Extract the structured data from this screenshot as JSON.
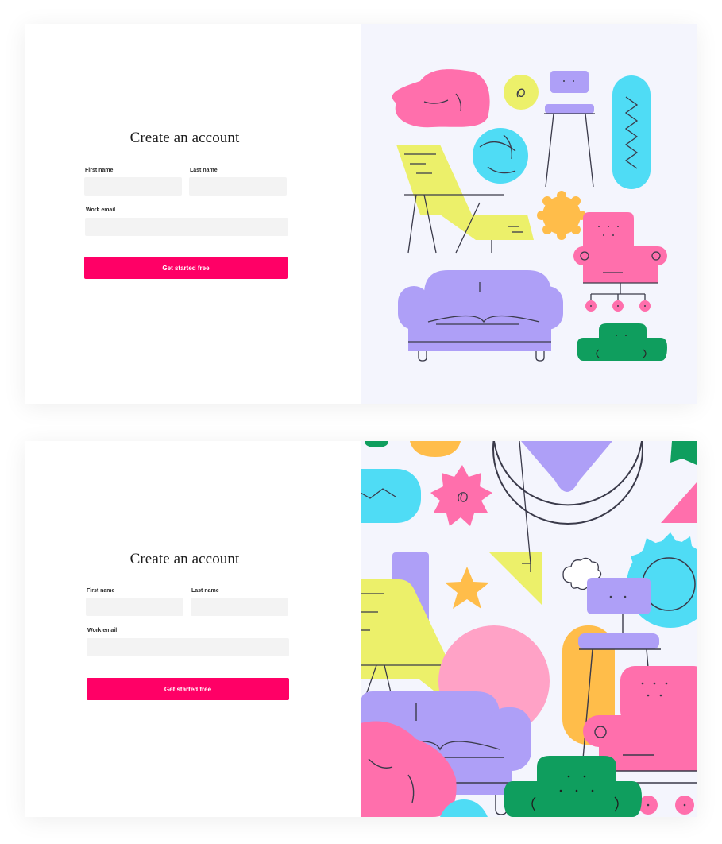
{
  "signup_forms": [
    {
      "title": "Create an account",
      "first_name_label": "First name",
      "last_name_label": "Last name",
      "work_email_label": "Work email",
      "first_name_value": "",
      "last_name_value": "",
      "work_email_value": "",
      "submit_label": "Get started free"
    },
    {
      "title": "Create an account",
      "first_name_label": "First name",
      "last_name_label": "Last name",
      "work_email_label": "Work email",
      "first_name_value": "",
      "last_name_value": "",
      "work_email_value": "",
      "submit_label": "Get started free"
    }
  ],
  "colors": {
    "button": "#ff0066",
    "input_bg": "#f3f3f3",
    "art_bg": "#f4f5fd",
    "pink": "#ff6fac",
    "purple": "#ae9ff7",
    "cyan": "#4fdcf5",
    "yellow": "#ecf06a",
    "orange": "#ffbd4a",
    "green": "#0f9e5e",
    "line": "#3a3a4a"
  },
  "icons": [
    "beanbag-icon",
    "swirl-circle-icon",
    "bar-stool-icon",
    "zigzag-pill-icon",
    "lounge-chair-icon",
    "ball-icon",
    "sunburst-icon",
    "office-chair-icon",
    "sofa-icon",
    "ottoman-icon",
    "diamond-icon",
    "star-icon",
    "arrow-icon",
    "cloud-icon"
  ]
}
